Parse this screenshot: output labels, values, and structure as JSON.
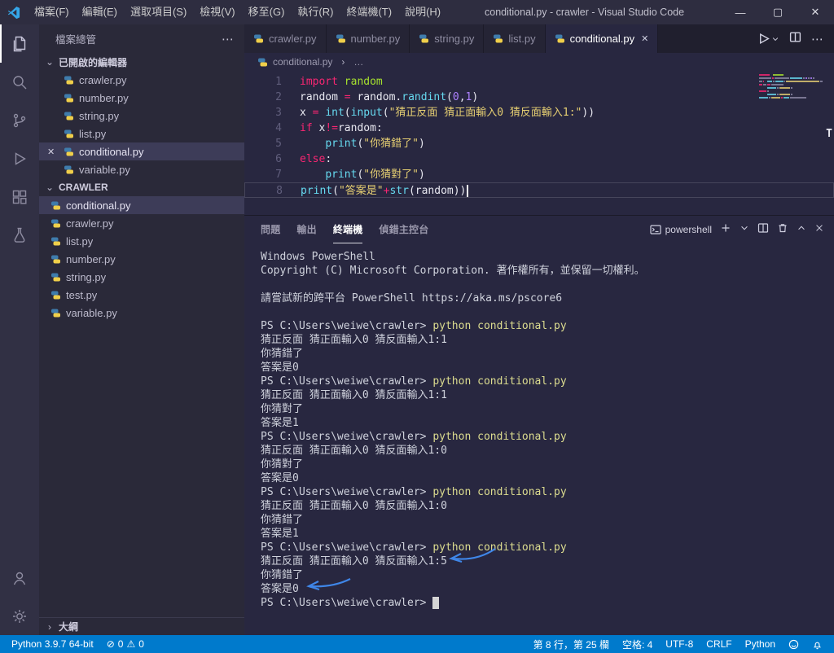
{
  "titlebar": {
    "app_title": "conditional.py - crawler - Visual Studio Code",
    "menus": [
      "檔案(F)",
      "編輯(E)",
      "選取項目(S)",
      "檢視(V)",
      "移至(G)",
      "執行(R)",
      "終端機(T)",
      "說明(H)"
    ]
  },
  "icons": {
    "minimize": "—",
    "maximize": "▢",
    "close": "✕",
    "more": "⋯",
    "chevron_down": "⌄",
    "chevron_right": "›",
    "error": "⊘",
    "warning": "⚠"
  },
  "activity_bar": [
    "explorer",
    "search",
    "source-control",
    "run-debug",
    "extensions",
    "testing",
    "account",
    "settings"
  ],
  "sidebar": {
    "title": "檔案總管",
    "open_editors": {
      "label": "已開啟的編輯器",
      "items": [
        {
          "name": "crawler.py",
          "active": false
        },
        {
          "name": "number.py",
          "active": false
        },
        {
          "name": "string.py",
          "active": false
        },
        {
          "name": "list.py",
          "active": false
        },
        {
          "name": "conditional.py",
          "active": true
        },
        {
          "name": "variable.py",
          "active": false
        }
      ]
    },
    "folder": {
      "label": "CRAWLER",
      "items": [
        {
          "name": "conditional.py",
          "selected": true
        },
        {
          "name": "crawler.py",
          "selected": false
        },
        {
          "name": "list.py",
          "selected": false
        },
        {
          "name": "number.py",
          "selected": false
        },
        {
          "name": "string.py",
          "selected": false
        },
        {
          "name": "test.py",
          "selected": false
        },
        {
          "name": "variable.py",
          "selected": false
        }
      ]
    },
    "outline": {
      "label": "大綱"
    }
  },
  "editor": {
    "tabs": [
      {
        "label": "crawler.py",
        "active": false
      },
      {
        "label": "number.py",
        "active": false
      },
      {
        "label": "string.py",
        "active": false
      },
      {
        "label": "list.py",
        "active": false
      },
      {
        "label": "conditional.py",
        "active": true
      }
    ],
    "breadcrumb": {
      "file": "conditional.py",
      "more": "…"
    },
    "overview_marker": "T",
    "code_lines": [
      {
        "num": 1,
        "tokens": [
          [
            "k",
            "import"
          ],
          [
            "p",
            " "
          ],
          [
            "m",
            "random"
          ]
        ]
      },
      {
        "num": 2,
        "tokens": [
          [
            "p",
            "random "
          ],
          [
            "k",
            "="
          ],
          [
            "p",
            " random."
          ],
          [
            "f",
            "randint"
          ],
          [
            "p",
            "("
          ],
          [
            "n",
            "0"
          ],
          [
            "p",
            ","
          ],
          [
            "n",
            "1"
          ],
          [
            "p",
            ")"
          ]
        ]
      },
      {
        "num": 3,
        "tokens": [
          [
            "p",
            "x "
          ],
          [
            "k",
            "="
          ],
          [
            "p",
            " "
          ],
          [
            "f",
            "int"
          ],
          [
            "p",
            "("
          ],
          [
            "f",
            "input"
          ],
          [
            "p",
            "("
          ],
          [
            "s",
            "\"猜正反面 猜正面輸入0 猜反面輸入1:\""
          ],
          [
            "p",
            "))"
          ]
        ]
      },
      {
        "num": 4,
        "tokens": [
          [
            "k",
            "if"
          ],
          [
            "p",
            " x"
          ],
          [
            "k",
            "!="
          ],
          [
            "p",
            "random:"
          ]
        ]
      },
      {
        "num": 5,
        "tokens": [
          [
            "p",
            "    "
          ],
          [
            "f",
            "print"
          ],
          [
            "p",
            "("
          ],
          [
            "s",
            "\"你猜錯了\""
          ],
          [
            "p",
            ")"
          ]
        ]
      },
      {
        "num": 6,
        "tokens": [
          [
            "k",
            "else"
          ],
          [
            "p",
            ":"
          ]
        ]
      },
      {
        "num": 7,
        "tokens": [
          [
            "p",
            "    "
          ],
          [
            "f",
            "print"
          ],
          [
            "p",
            "("
          ],
          [
            "s",
            "\"你猜對了\""
          ],
          [
            "p",
            ")"
          ]
        ]
      },
      {
        "num": 8,
        "tokens": [
          [
            "f",
            "print"
          ],
          [
            "p",
            "("
          ],
          [
            "s",
            "\"答案是\""
          ],
          [
            "k",
            "+"
          ],
          [
            "f",
            "str"
          ],
          [
            "p",
            "(random))"
          ]
        ],
        "cursor": true
      }
    ]
  },
  "panel": {
    "tabs": [
      {
        "label": "問題",
        "active": false
      },
      {
        "label": "輸出",
        "active": false
      },
      {
        "label": "終端機",
        "active": true
      },
      {
        "label": "偵錯主控台",
        "active": false
      }
    ],
    "shell_label": "powershell",
    "terminal": {
      "lines": [
        {
          "spans": [
            [
              "p",
              "Windows PowerShell"
            ]
          ]
        },
        {
          "spans": [
            [
              "p",
              "Copyright (C) Microsoft Corporation. 著作權所有，並保留一切權利。"
            ]
          ]
        },
        {
          "spans": []
        },
        {
          "spans": [
            [
              "p",
              "請嘗試新的跨平台 PowerShell https://aka.ms/pscore6"
            ]
          ]
        },
        {
          "spans": []
        },
        {
          "spans": [
            [
              "p",
              "PS C:\\Users\\weiwe\\crawler> "
            ],
            [
              "c",
              "python conditional.py"
            ]
          ]
        },
        {
          "spans": [
            [
              "p",
              "猜正反面 猜正面輸入0 猜反面輸入1:1"
            ]
          ]
        },
        {
          "spans": [
            [
              "p",
              "你猜錯了"
            ]
          ]
        },
        {
          "spans": [
            [
              "p",
              "答案是0"
            ]
          ]
        },
        {
          "spans": [
            [
              "p",
              "PS C:\\Users\\weiwe\\crawler> "
            ],
            [
              "c",
              "python conditional.py"
            ]
          ]
        },
        {
          "spans": [
            [
              "p",
              "猜正反面 猜正面輸入0 猜反面輸入1:1"
            ]
          ]
        },
        {
          "spans": [
            [
              "p",
              "你猜對了"
            ]
          ]
        },
        {
          "spans": [
            [
              "p",
              "答案是1"
            ]
          ]
        },
        {
          "spans": [
            [
              "p",
              "PS C:\\Users\\weiwe\\crawler> "
            ],
            [
              "c",
              "python conditional.py"
            ]
          ]
        },
        {
          "spans": [
            [
              "p",
              "猜正反面 猜正面輸入0 猜反面輸入1:0"
            ]
          ]
        },
        {
          "spans": [
            [
              "p",
              "你猜對了"
            ]
          ]
        },
        {
          "spans": [
            [
              "p",
              "答案是0"
            ]
          ]
        },
        {
          "spans": [
            [
              "p",
              "PS C:\\Users\\weiwe\\crawler> "
            ],
            [
              "c",
              "python conditional.py"
            ]
          ]
        },
        {
          "spans": [
            [
              "p",
              "猜正反面 猜正面輸入0 猜反面輸入1:0"
            ]
          ]
        },
        {
          "spans": [
            [
              "p",
              "你猜錯了"
            ]
          ]
        },
        {
          "spans": [
            [
              "p",
              "答案是1"
            ]
          ]
        },
        {
          "spans": [
            [
              "p",
              "PS C:\\Users\\weiwe\\crawler> "
            ],
            [
              "c",
              "python conditional.py"
            ]
          ]
        },
        {
          "spans": [
            [
              "p",
              "猜正反面 猜正面輸入0 猜反面輸入1:5"
            ]
          ]
        },
        {
          "spans": [
            [
              "p",
              "你猜錯了"
            ]
          ]
        },
        {
          "spans": [
            [
              "p",
              "答案是0"
            ]
          ]
        },
        {
          "spans": [
            [
              "p",
              "PS C:\\Users\\weiwe\\crawler> "
            ]
          ],
          "cursor": true
        }
      ]
    },
    "annotations": [
      {
        "type": "arrow",
        "color": "#3f86e8",
        "points_to": "猜反面輸入1:5"
      },
      {
        "type": "arrow",
        "color": "#3f86e8",
        "points_to": "答案是0"
      }
    ]
  },
  "statusbar": {
    "interpreter": "Python 3.9.7 64-bit",
    "problems": {
      "errors": "0",
      "warnings": "0"
    },
    "right": [
      {
        "id": "cursor-position",
        "label": "第 8 行，第 25 欄"
      },
      {
        "id": "indentation",
        "label": "空格: 4"
      },
      {
        "id": "encoding",
        "label": "UTF-8"
      },
      {
        "id": "eol",
        "label": "CRLF"
      },
      {
        "id": "language",
        "label": "Python"
      }
    ]
  }
}
